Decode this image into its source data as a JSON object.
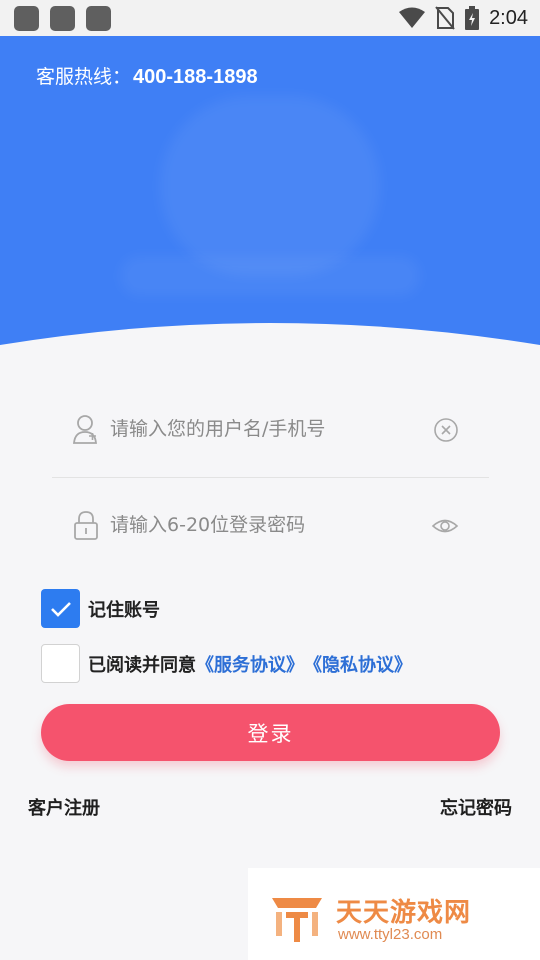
{
  "status_bar": {
    "time": "2:04"
  },
  "header": {
    "hotline_label": "客服热线：",
    "hotline_number": "400-188-1898"
  },
  "form": {
    "username_placeholder": "请输入您的用户名/手机号",
    "password_placeholder": "请输入6-20位登录密码",
    "remember_label": "记住账号",
    "remember_checked": true,
    "agreement_prefix": "已阅读并同意",
    "service_agreement_link": "《服务协议》",
    "privacy_agreement_link": "《隐私协议》",
    "agreement_checked": false,
    "login_button": "登录"
  },
  "footer": {
    "register_link": "客户注册",
    "forgot_link": "忘记密码"
  },
  "watermark": {
    "title": "天天游戏网",
    "url": "www.ttyl23.com"
  },
  "colors": {
    "header_blue": "#3f7ff5",
    "login_red": "#f5536d",
    "checkbox_blue": "#2d7cf0",
    "link_blue": "#2d6fd6",
    "watermark_orange": "#ee8a45"
  },
  "icons": [
    "user-icon",
    "lock-icon",
    "clear-icon",
    "eye-icon",
    "check-icon",
    "wifi-icon",
    "no-sim-icon",
    "battery-icon"
  ]
}
